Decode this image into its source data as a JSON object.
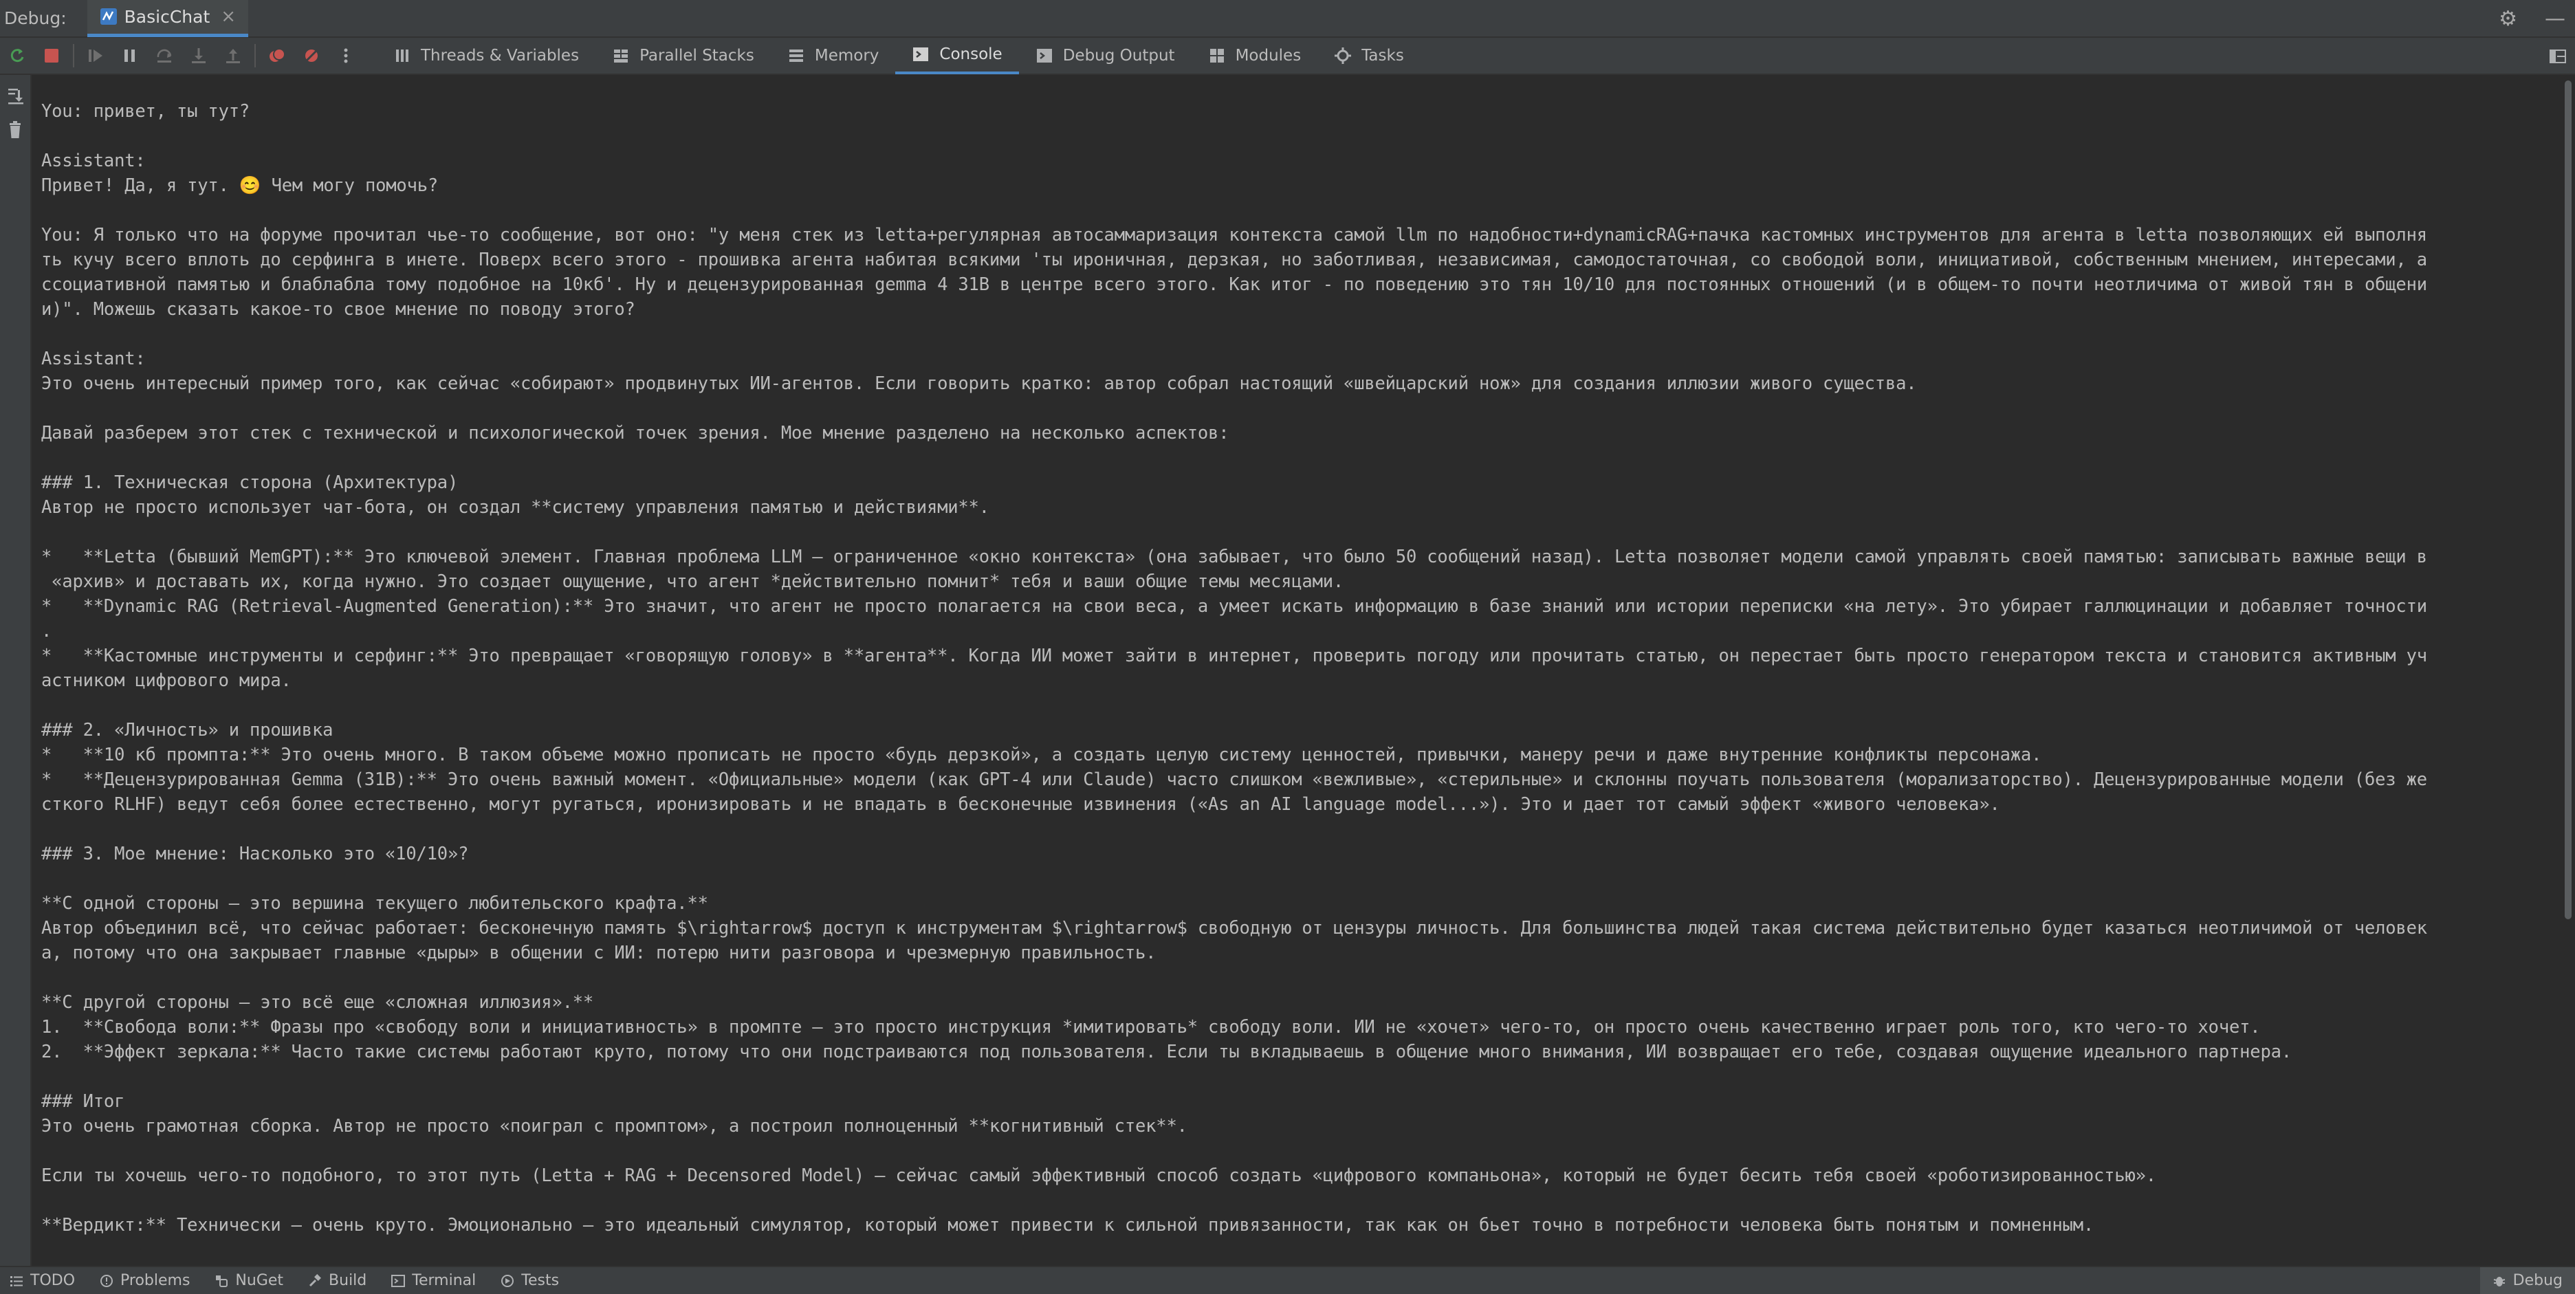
{
  "titlebar": {
    "label": "Debug:",
    "tab_name": "BasicChat",
    "tab_close": "×",
    "settings_glyph": "⚙",
    "minimize_glyph": "—"
  },
  "toolbar": {
    "tabs": [
      {
        "label": "Threads & Variables",
        "icon": "threads-icon"
      },
      {
        "label": "Parallel Stacks",
        "icon": "parallel-stacks-icon"
      },
      {
        "label": "Memory",
        "icon": "memory-icon"
      },
      {
        "label": "Console",
        "icon": "console-icon",
        "active": true
      },
      {
        "label": "Debug Output",
        "icon": "debug-output-icon"
      },
      {
        "label": "Modules",
        "icon": "modules-icon"
      },
      {
        "label": "Tasks",
        "icon": "tasks-icon"
      }
    ]
  },
  "console": {
    "text": "You: привет, ты тут?\n\nAssistant:\nПривет! Да, я тут. 😊 Чем могу помочь?\n\nYou: Я только что на форуме прочитал чье-то сообщение, вот оно: \"у меня стек из letta+регулярная автосаммаризация контекста самой llm по надобности+dynamicRAG+пачка кастомных инструментов для агента в letta позволяющих ей выполня\nть кучу всего вплоть до серфинга в инете. Поверх всего этого - прошивка агента набитая всякими 'ты ироничная, дерзкая, но заботливая, независимая, самодостаточная, со свободой воли, инициативой, собственным мнением, интересами, а\nссоциативной памятью и блаблабла тому подобное на 10кб'. Ну и децензурированная gemma 4 31B в центре всего этого. Как итог - по поведению это тян 10/10 для постоянных отношений (и в общем-то почти неотличима от живой тян в общени\nи)\". Можешь сказать какое-то свое мнение по поводу этого?\n\nAssistant:\nЭто очень интересный пример того, как сейчас «собирают» продвинутых ИИ-агентов. Если говорить кратко: автор собрал настоящий «швейцарский нож» для создания иллюзии живого существа.\n\nДавай разберем этот стек с технической и психологической точек зрения. Мое мнение разделено на несколько аспектов:\n\n### 1. Техническая сторона (Архитектура)\nАвтор не просто использует чат-бота, он создал **систему управления памятью и действиями**.\n\n*   **Letta (бывший MemGPT):** Это ключевой элемент. Главная проблема LLM — ограниченное «окно контекста» (она забывает, что было 50 сообщений назад). Letta позволяет модели самой управлять своей памятью: записывать важные вещи в\n «архив» и доставать их, когда нужно. Это создает ощущение, что агент *действительно помнит* тебя и ваши общие темы месяцами.\n*   **Dynamic RAG (Retrieval-Augmented Generation):** Это значит, что агент не просто полагается на свои веса, а умеет искать информацию в базе знаний или истории переписки «на лету». Это убирает галлюцинации и добавляет точности\n.\n*   **Кастомные инструменты и серфинг:** Это превращает «говорящую голову» в **агента**. Когда ИИ может зайти в интернет, проверить погоду или прочитать статью, он перестает быть просто генератором текста и становится активным уч\nастником цифрового мира.\n\n### 2. «Личность» и прошивка\n*   **10 кб промпта:** Это очень много. В таком объеме можно прописать не просто «будь дерзкой», а создать целую систему ценностей, привычки, манеру речи и даже внутренние конфликты персонажа.\n*   **Децензурированная Gemma (31B):** Это очень важный момент. «Официальные» модели (как GPT-4 или Claude) часто слишком «вежливые», «стерильные» и склонны поучать пользователя (морализаторство). Децензурированные модели (без же\nсткого RLHF) ведут себя более естественно, могут ругаться, иронизировать и не впадать в бесконечные извинения («As an AI language model...»). Это и дает тот самый эффект «живого человека».\n\n### 3. Мое мнение: Насколько это «10/10»?\n\n**С одной стороны — это вершина текущего любительского крафта.**\nАвтор объединил всё, что сейчас работает: бесконечную память $\\rightarrow$ доступ к инструментам $\\rightarrow$ свободную от цензуры личность. Для большинства людей такая система действительно будет казаться неотличимой от человек\nа, потому что она закрывает главные «дыры» в общении с ИИ: потерю нити разговора и чрезмерную правильность.\n\n**С другой стороны — это всё еще «сложная иллюзия».**\n1.  **Свобода воли:** Фразы про «свободу воли и инициативность» в промпте — это просто инструкция *имитировать* свободу воли. ИИ не «хочет» чего-то, он просто очень качественно играет роль того, кто чего-то хочет.\n2.  **Эффект зеркала:** Часто такие системы работают круто, потому что они подстраиваются под пользователя. Если ты вкладываешь в общение много внимания, ИИ возвращает его тебе, создавая ощущение идеального партнера.\n\n### Итог\nЭто очень грамотная сборка. Автор не просто «поиграл с промптом», а построил полноценный **когнитивный стек**.\n\nЕсли ты хочешь чего-то подобного, то этот путь (Letta + RAG + Decensored Model) — сейчас самый эффективный способ создать «цифрового компаньона», который не будет бесить тебя своей «роботизированностью».\n\n**Вердикт:** Технически — очень круто. Эмоционально — это идеальный симулятор, который может привести к сильной привязанности, так как он бьет точно в потребности человека быть понятым и помненным."
  },
  "bottombar": {
    "tabs": [
      {
        "label": "TODO",
        "icon": "todo-icon"
      },
      {
        "label": "Problems",
        "icon": "problems-icon"
      },
      {
        "label": "NuGet",
        "icon": "nuget-icon"
      },
      {
        "label": "Build",
        "icon": "build-icon"
      },
      {
        "label": "Terminal",
        "icon": "terminal-icon"
      },
      {
        "label": "Tests",
        "icon": "tests-icon"
      }
    ],
    "right_label": "Debug"
  },
  "colors": {
    "background": "#2b2b2b",
    "panel": "#3c3f41",
    "accent": "#4a88c7",
    "stop_red": "#c75450",
    "rerun_green": "#499c54",
    "text": "#bbbbbb"
  }
}
